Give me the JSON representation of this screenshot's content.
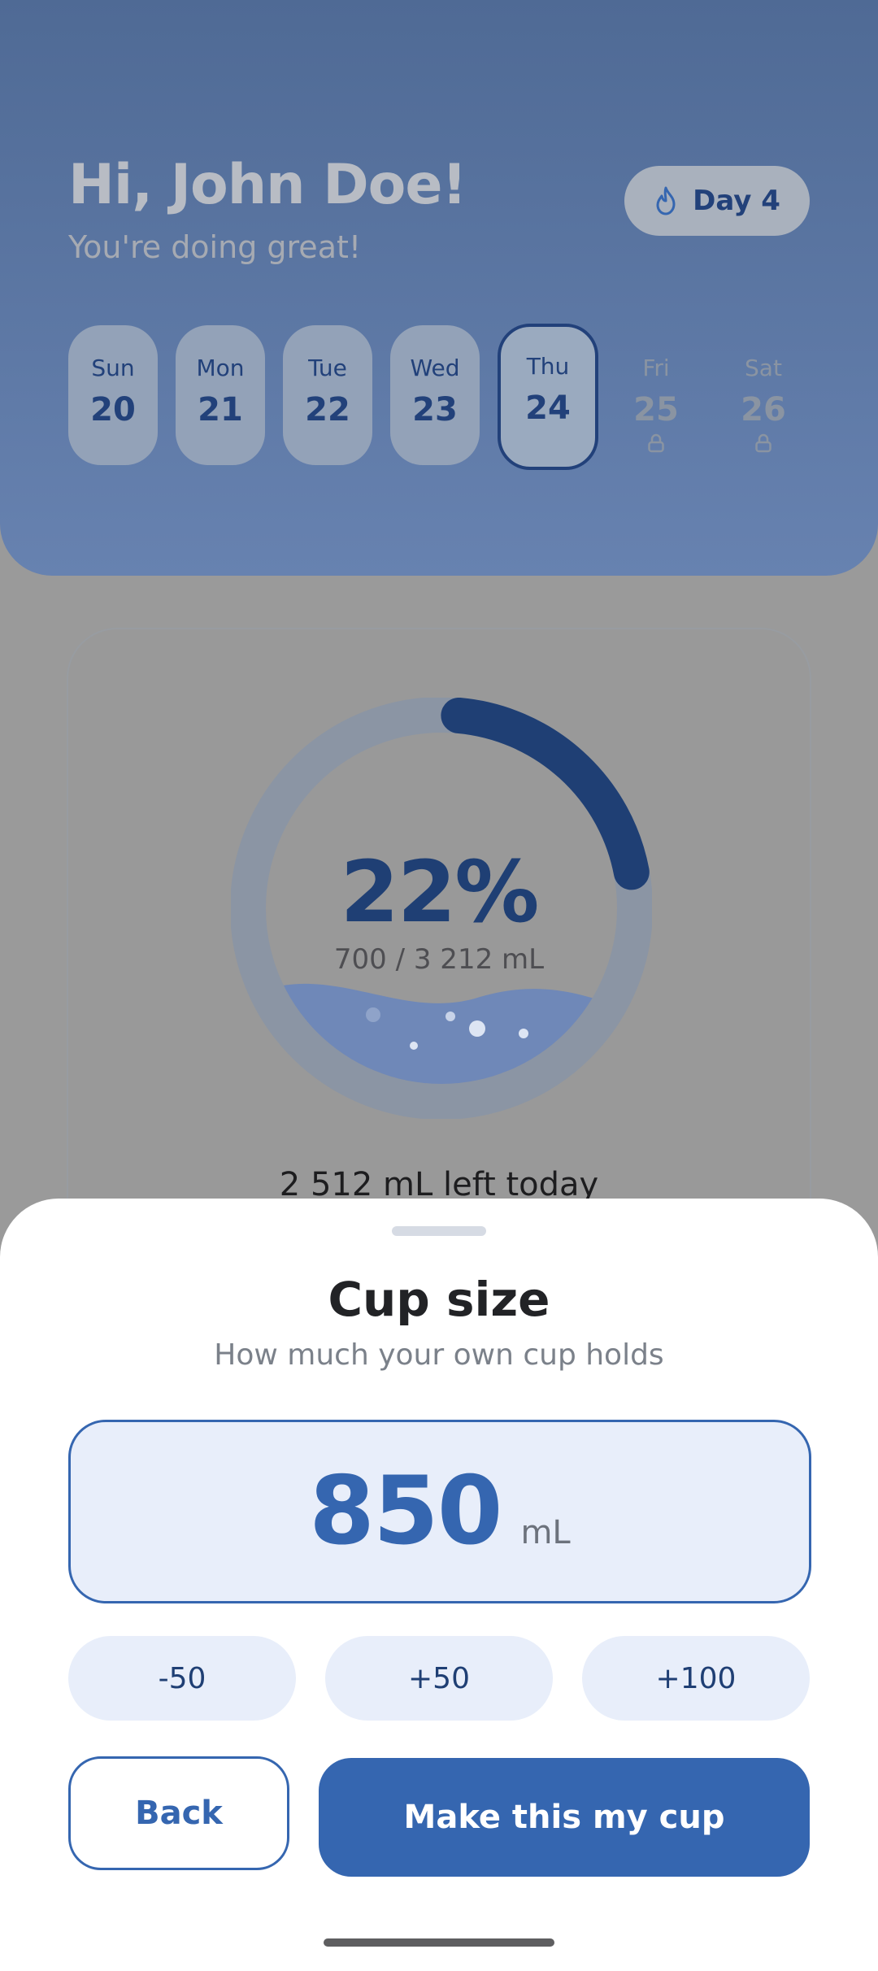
{
  "header": {
    "greeting": "Hi, John Doe!",
    "subtitle": "You're doing great!",
    "streak": {
      "icon": "flame-icon",
      "label": "Day 4"
    }
  },
  "days": [
    {
      "name": "Sun",
      "num": "20",
      "state": "done"
    },
    {
      "name": "Mon",
      "num": "21",
      "state": "done"
    },
    {
      "name": "Tue",
      "num": "22",
      "state": "done"
    },
    {
      "name": "Wed",
      "num": "23",
      "state": "done"
    },
    {
      "name": "Thu",
      "num": "24",
      "state": "today"
    },
    {
      "name": "Fri",
      "num": "25",
      "state": "locked"
    },
    {
      "name": "Sat",
      "num": "26",
      "state": "locked"
    }
  ],
  "progress": {
    "percent_label": "22%",
    "fraction": 0.22,
    "amount": "700 / 3 212 mL",
    "left_today": "2 512 mL left today"
  },
  "sheet": {
    "title": "Cup size",
    "subtitle": "How much your own cup holds",
    "value": "850",
    "unit": "mL",
    "steps": [
      "-50",
      "+50",
      "+100"
    ],
    "back_label": "Back",
    "confirm_label": "Make this my cup"
  },
  "colors": {
    "accent": "#3566b0",
    "dark_blue": "#22417a",
    "light_fill": "#e8eefa"
  }
}
